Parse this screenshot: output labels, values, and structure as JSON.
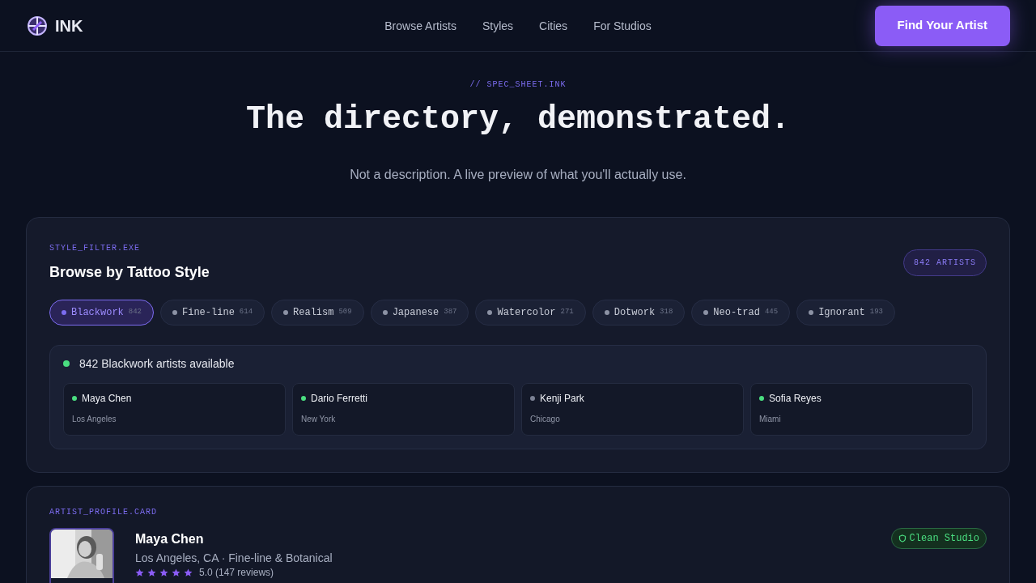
{
  "brand": {
    "name": "INK"
  },
  "nav": [
    "Browse Artists",
    "Styles",
    "Cities",
    "For Studios"
  ],
  "cta": "Find Your Artist",
  "hero": {
    "eyebrow": "// SPEC_SHEET.INK",
    "title": "The directory, demonstrated.",
    "subtitle": "Not a description. A live preview of what you'll actually use."
  },
  "style_filter": {
    "eyebrow": "STYLE_FILTER.EXE",
    "title": "Browse by Tattoo Style",
    "count_badge": "842 ARTISTS",
    "chips": [
      {
        "label": "Blackwork",
        "count": "842",
        "selected": true
      },
      {
        "label": "Fine-line",
        "count": "614",
        "selected": false
      },
      {
        "label": "Realism",
        "count": "509",
        "selected": false
      },
      {
        "label": "Japanese",
        "count": "387",
        "selected": false
      },
      {
        "label": "Watercolor",
        "count": "271",
        "selected": false
      },
      {
        "label": "Dotwork",
        "count": "318",
        "selected": false
      },
      {
        "label": "Neo-trad",
        "count": "445",
        "selected": false
      },
      {
        "label": "Ignorant",
        "count": "193",
        "selected": false
      }
    ],
    "results": {
      "summary": "842 Blackwork artists available",
      "artists": [
        {
          "name": "Maya Chen",
          "city": "Los Angeles",
          "online": true
        },
        {
          "name": "Dario Ferretti",
          "city": "New York",
          "online": true
        },
        {
          "name": "Kenji Park",
          "city": "Chicago",
          "online": false
        },
        {
          "name": "Sofia Reyes",
          "city": "Miami",
          "online": true
        }
      ]
    }
  },
  "profile": {
    "eyebrow": "ARTIST_PROFILE.CARD",
    "name": "Maya Chen",
    "meta": "Los Angeles, CA · Fine-line & Botanical",
    "stars": 5,
    "rating": "5.0 (147 reviews)",
    "badge": "Clean Studio"
  }
}
